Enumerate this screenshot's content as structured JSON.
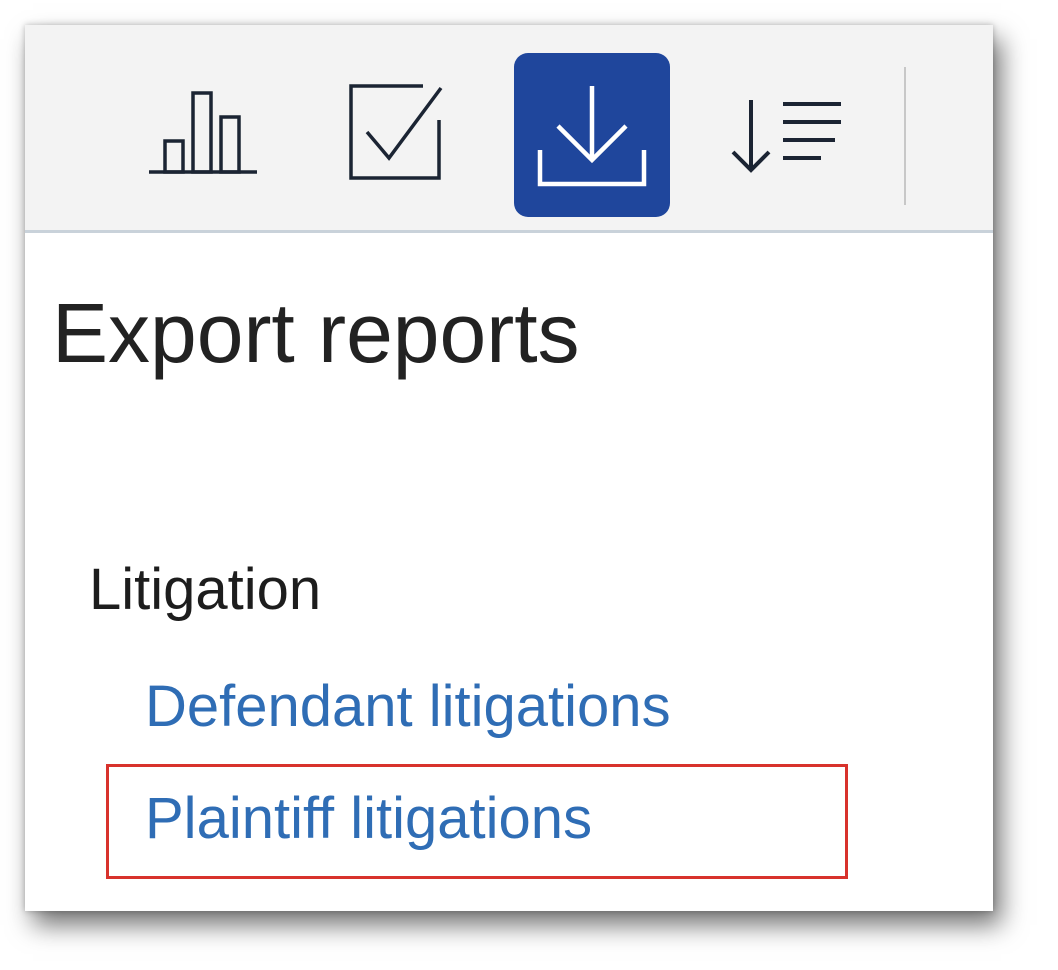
{
  "toolbar": {
    "buttons": [
      {
        "icon": "bar-chart-icon",
        "active": false
      },
      {
        "icon": "checkbox-checked-icon",
        "active": false
      },
      {
        "icon": "download-icon",
        "active": true
      },
      {
        "icon": "sort-descending-list-icon",
        "active": false
      }
    ],
    "active_color": "#1f469c"
  },
  "main": {
    "title": "Export reports",
    "sections": [
      {
        "heading": "Litigation",
        "links": [
          {
            "label": "Defendant litigations"
          },
          {
            "label": "Plaintiff litigations",
            "highlighted": true
          }
        ]
      }
    ]
  },
  "colors": {
    "link": "#2f6db5",
    "highlight_border": "#d8322c",
    "toolbar_bg": "#f3f3f3"
  }
}
